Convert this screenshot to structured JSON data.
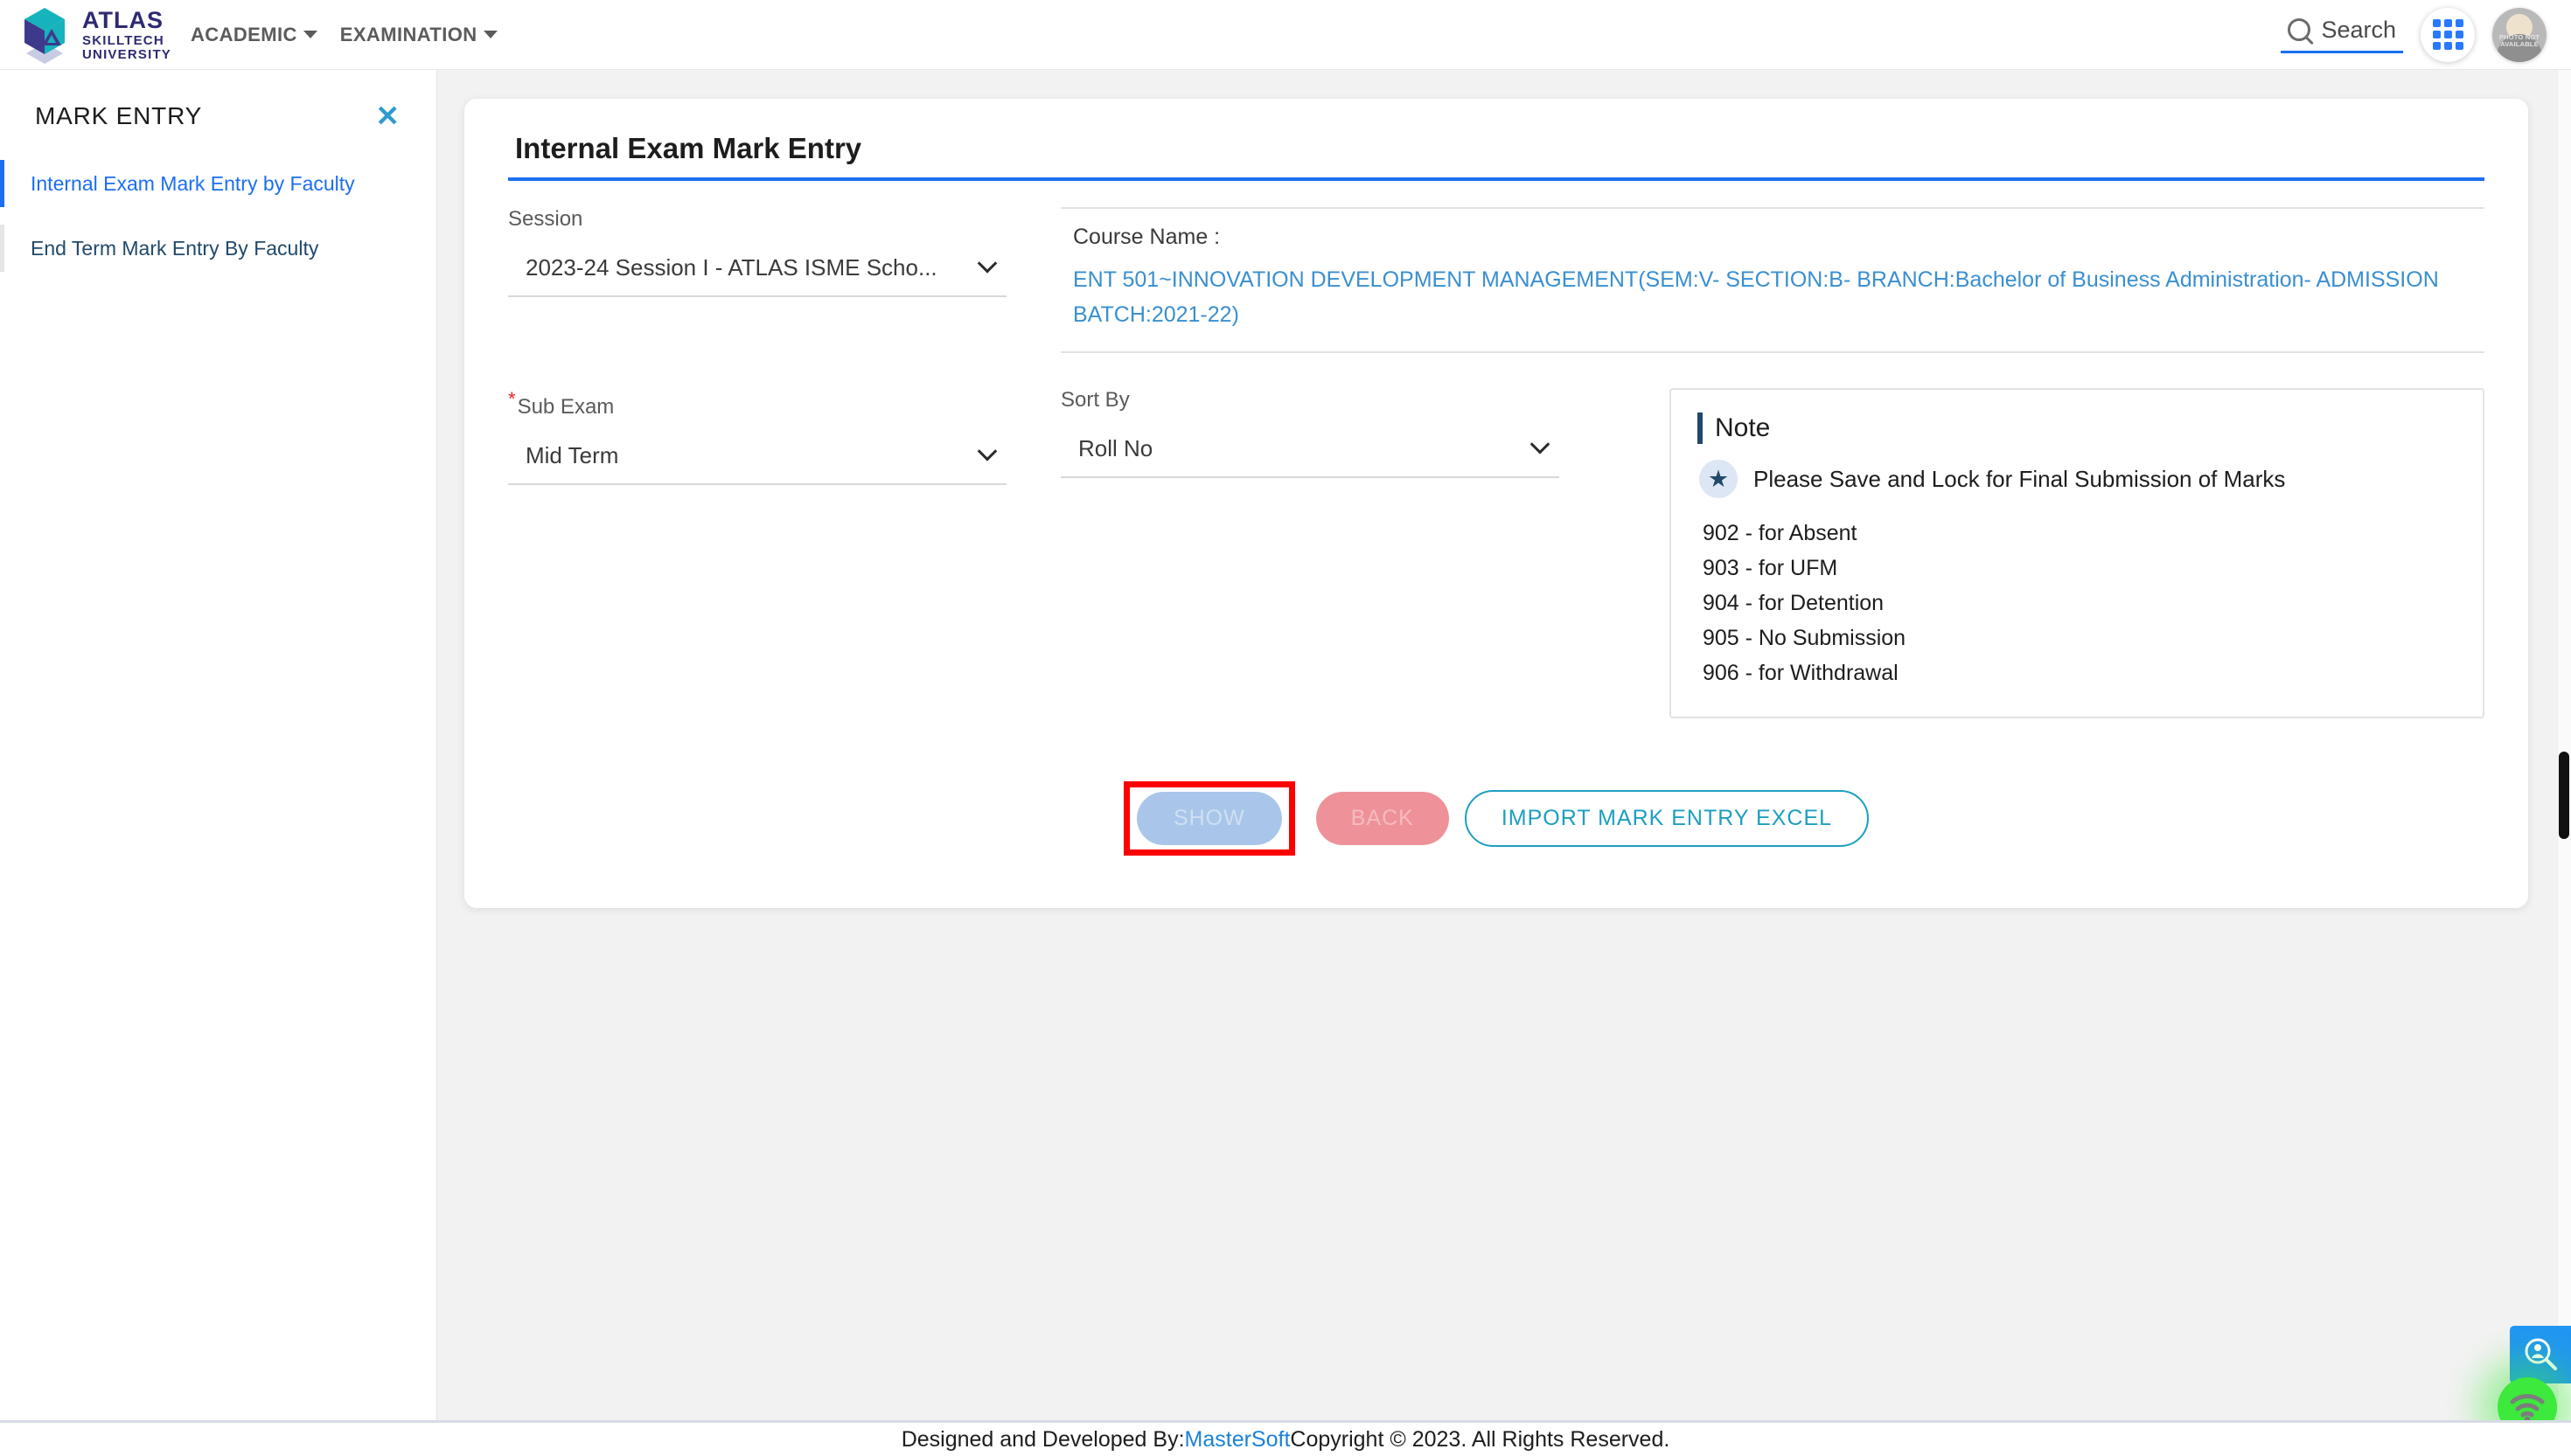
{
  "header": {
    "logo": {
      "brand": "ATLAS",
      "line2": "SKILLTECH",
      "line3": "UNIVERSITY"
    },
    "nav": [
      {
        "label": "ACADEMIC"
      },
      {
        "label": "EXAMINATION"
      }
    ],
    "search": {
      "label": "Search",
      "placeholder": "Search"
    },
    "avatar_text": "PHOTO NOT AVAILABLE"
  },
  "sidebar": {
    "title": "MARK ENTRY",
    "close": "✕",
    "items": [
      {
        "label": "Internal Exam Mark Entry by Faculty",
        "active": true
      },
      {
        "label": "End Term Mark Entry By Faculty",
        "active": false
      }
    ]
  },
  "main": {
    "page_title": "Internal Exam Mark Entry",
    "session": {
      "label": "Session",
      "value": "2023-24 Session I - ATLAS ISME Scho..."
    },
    "course": {
      "label": "Course Name :",
      "value": "ENT 501~INNOVATION DEVELOPMENT MANAGEMENT(SEM:V- SECTION:B- BRANCH:Bachelor of Business Administration- ADMISSION BATCH:2021-22)"
    },
    "sub_exam": {
      "label": "Sub Exam",
      "required_marker": "*",
      "value": "Mid Term"
    },
    "sort_by": {
      "label": "Sort By",
      "value": "Roll No"
    },
    "note": {
      "title": "Note",
      "highlight": "Please Save and Lock for Final Submission of Marks",
      "star_glyph": "★",
      "codes": [
        "902 - for Absent",
        "903 - for UFM",
        "904 - for Detention",
        "905 - No Submission",
        "906 - for Withdrawal"
      ]
    },
    "buttons": {
      "show": "SHOW",
      "back": "BACK",
      "import": "IMPORT MARK ENTRY EXCEL"
    }
  },
  "footer": {
    "prefix": "Designed and Developed By: ",
    "link": "MasterSoft",
    "suffix": " Copyright © 2023. All Rights Reserved."
  },
  "colors": {
    "accent_blue": "#1b6ff0",
    "link_blue": "#3a8fd0",
    "teal": "#1c9fc0",
    "highlight_red": "#ff0000",
    "note_navy": "#21496b",
    "brand_purple": "#2e2a72",
    "brand_teal": "#16b3bd"
  }
}
